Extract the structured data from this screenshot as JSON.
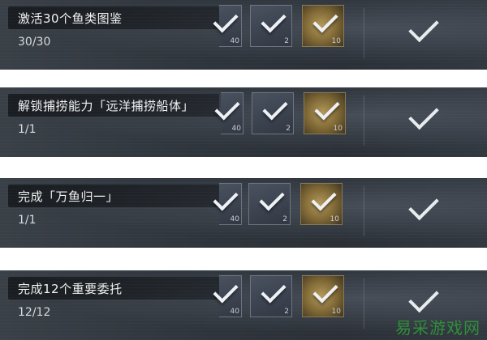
{
  "tasks": [
    {
      "title": "激活30个鱼类图鉴",
      "progress": "30/30",
      "rewards": [
        {
          "icon": "check-icon",
          "qty": "40"
        },
        {
          "icon": "check-icon",
          "qty": "2"
        },
        {
          "icon": "gold-shell-icon",
          "qty": "10"
        }
      ]
    },
    {
      "title": "解锁捕捞能力「远洋捕捞船体」",
      "progress": "1/1",
      "rewards": [
        {
          "icon": "check-icon",
          "qty": "40"
        },
        {
          "icon": "check-icon",
          "qty": "2"
        },
        {
          "icon": "gold-shell-icon",
          "qty": "10"
        }
      ]
    },
    {
      "title": "完成「万鱼归一」",
      "progress": "1/1",
      "rewards": [
        {
          "icon": "check-icon",
          "qty": "40"
        },
        {
          "icon": "check-icon",
          "qty": "2"
        },
        {
          "icon": "gold-shell-icon",
          "qty": "10"
        }
      ]
    },
    {
      "title": "完成12个重要委托",
      "progress": "12/12",
      "rewards": [
        {
          "icon": "check-icon",
          "qty": "40"
        },
        {
          "icon": "check-icon",
          "qty": "2"
        },
        {
          "icon": "gold-shell-icon",
          "qty": "10"
        }
      ]
    }
  ],
  "watermark": "易采游戏网",
  "colors": {
    "card_bg": "#2f353c",
    "text": "#f1f1f1",
    "check": "#e9ecef",
    "watermark": "#2f8f3a"
  }
}
